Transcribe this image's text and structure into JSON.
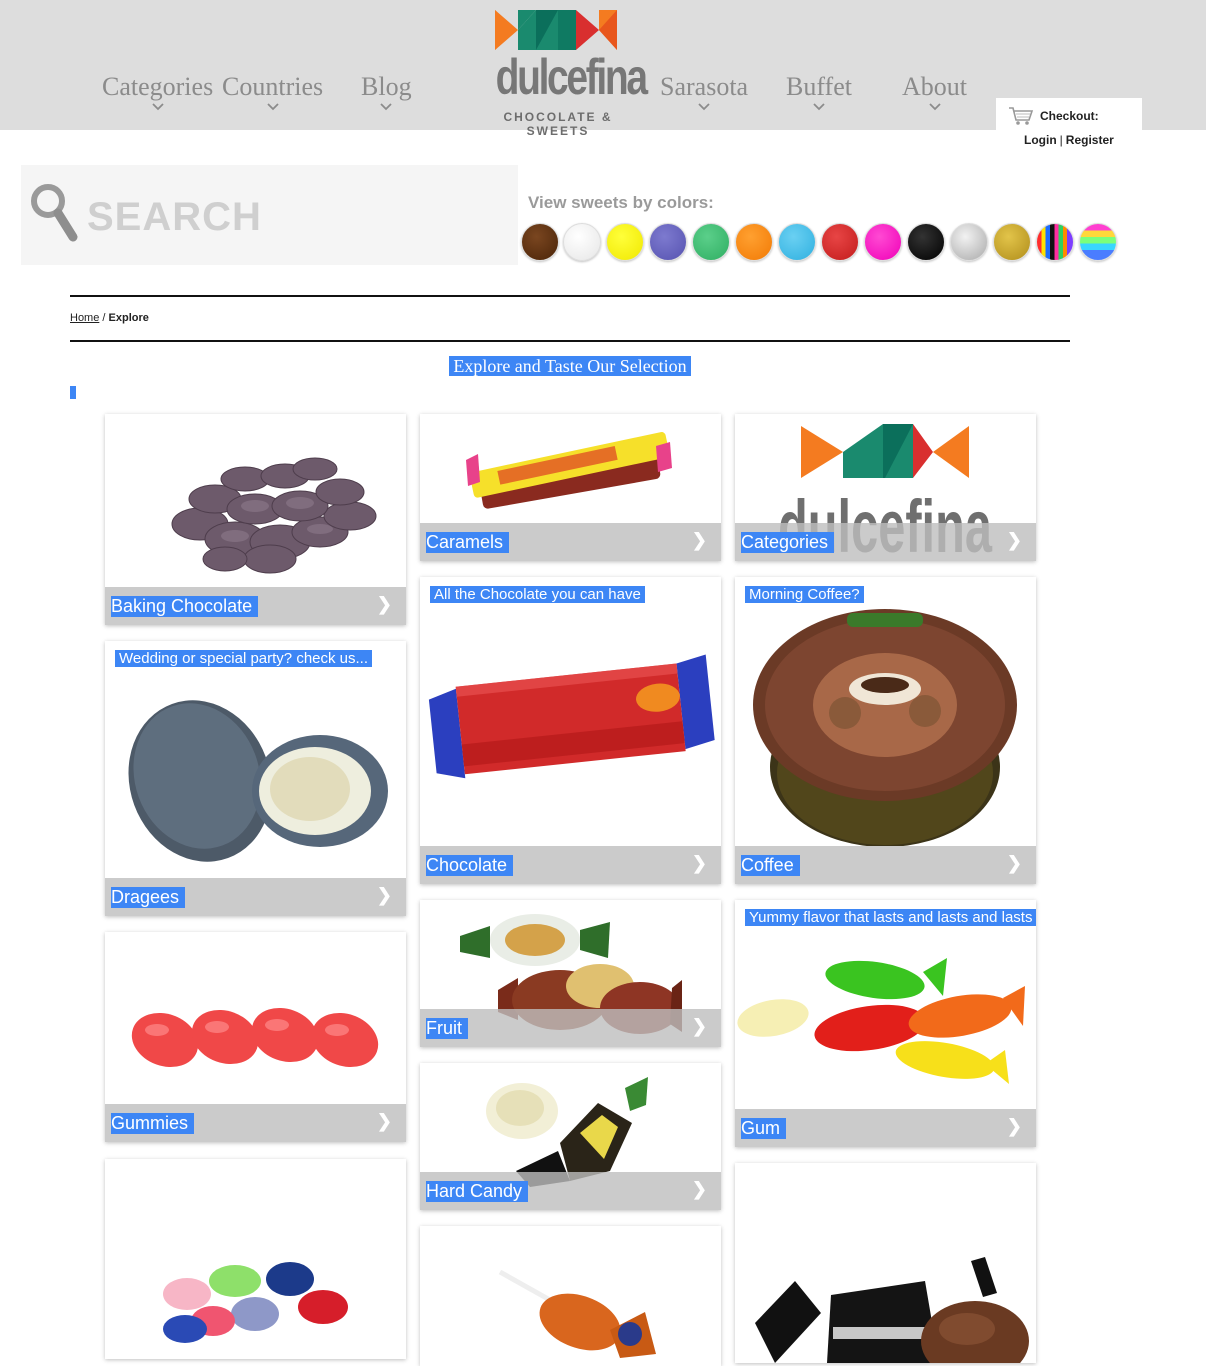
{
  "nav": {
    "left": [
      {
        "label": "Categories"
      },
      {
        "label": "Countries"
      },
      {
        "label": "Blog"
      }
    ],
    "right": [
      {
        "label": "Sarasota"
      },
      {
        "label": "Buffet"
      },
      {
        "label": "About"
      }
    ]
  },
  "logo": {
    "name": "dulcefina",
    "tagline": "CHOCOLATE & SWEETS"
  },
  "account": {
    "checkout": "Checkout:",
    "login": "Login",
    "separator": "|",
    "register": "Register"
  },
  "search": {
    "placeholder": "SEARCH"
  },
  "colors": {
    "label": "View sweets by colors:",
    "swatches": [
      "brown",
      "white",
      "yellow",
      "purple",
      "green",
      "orange",
      "light-blue",
      "red",
      "pink",
      "black",
      "silver",
      "gold",
      "striped",
      "rainbow"
    ]
  },
  "breadcrumb": {
    "home": "Home",
    "separator": " / ",
    "current": "Explore"
  },
  "page_title": "Explore and Taste Our Selection",
  "cards": [
    {
      "label": "Baking Chocolate",
      "tagline": "",
      "image": "chocolate-wafers"
    },
    {
      "label": "Caramels",
      "tagline": "",
      "image": "caramel-bars"
    },
    {
      "label": "Categories",
      "tagline": "",
      "image": "dulcefina-logo"
    },
    {
      "label": "Chocolate",
      "tagline": "All the Chocolate you can have",
      "image": "taami-bar"
    },
    {
      "label": "Coffee",
      "tagline": "Morning Coffee?",
      "image": "coffee-tin"
    },
    {
      "label": "Dragees",
      "tagline": "Wedding or special party? check us...",
      "image": "dragees"
    },
    {
      "label": "Fruit",
      "tagline": "",
      "image": "fruit-candies"
    },
    {
      "label": "Gum",
      "tagline": "Yummy flavor that lasts and lasts and lasts",
      "image": "gummy-fish"
    },
    {
      "label": "Gummies",
      "tagline": "",
      "image": "red-gummies"
    },
    {
      "label": "Hard Candy",
      "tagline": "",
      "image": "hard-candy"
    },
    {
      "label": "",
      "tagline": "",
      "image": "jelly-beans"
    },
    {
      "label": "",
      "tagline": "",
      "image": "lollipop"
    },
    {
      "label": "",
      "tagline": "",
      "image": "licorice-candies"
    }
  ],
  "arrow": "❯"
}
